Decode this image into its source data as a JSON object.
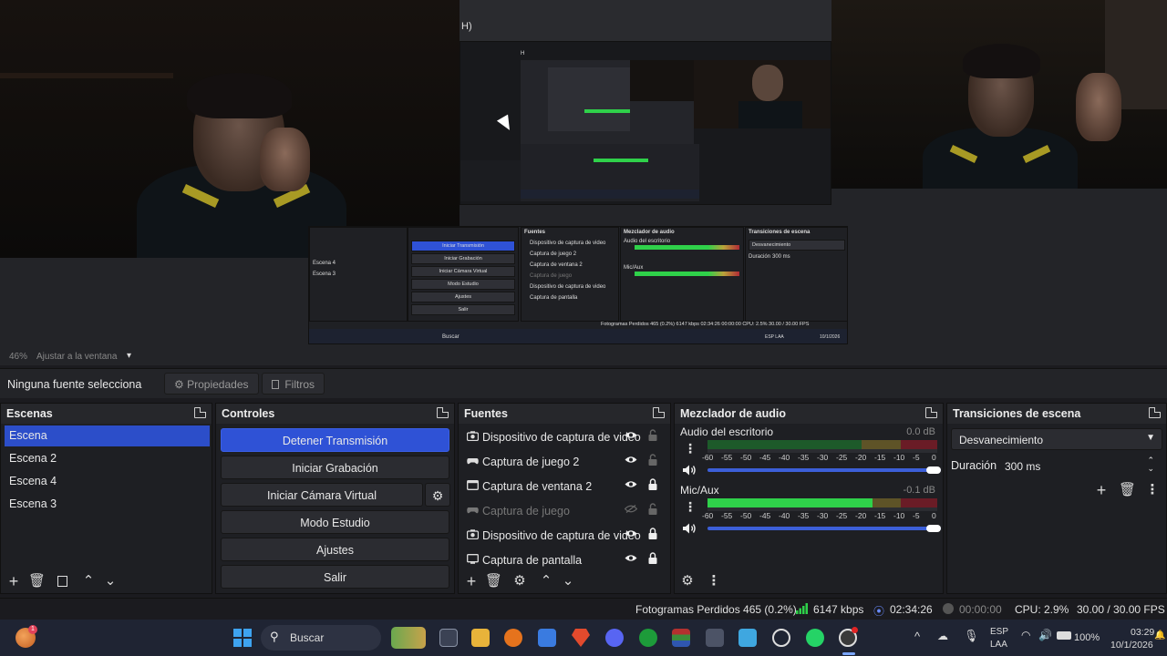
{
  "preview": {
    "nested_header_fragment": "H)",
    "nested_inner_fragment": "H",
    "nested_ui": {
      "scene_items": [
        "Escena 4",
        "Escena 3"
      ],
      "controls": [
        "Iniciar Transmisión",
        "Iniciar Grabación",
        "Iniciar Cámara Virtual",
        "Modo Estudio",
        "Ajustes",
        "Salir"
      ],
      "sources_title": "Fuentes",
      "sources": [
        "Dispositivo de captura de video",
        "Captura de juego 2",
        "Captura de ventana 2",
        "Captura de juego",
        "Dispositivo de captura de video",
        "Captura de pantalla"
      ],
      "mixer_title": "Mezclador de audio",
      "mixer_channels": [
        "Audio del escritorio",
        "Mic/Aux"
      ],
      "transitions_title": "Transiciones de escena",
      "transition": "Desvanecimiento",
      "duration_label": "Duración",
      "duration_value": "300 ms",
      "status": "Fotogramas Perdidos 465 (0.2%)   6147 kbps   02:34:26   00:00:00   CPU: 2.5%   30.00 / 30.00 FPS",
      "search": "Buscar",
      "lang": "ESP LAA",
      "clock": "10/1/2026"
    }
  },
  "zoom": {
    "percent": "46%",
    "mode": "Ajustar a la ventana"
  },
  "context_bar": {
    "label": "Ninguna fuente selecciona",
    "properties": "Propiedades",
    "filters": "Filtros"
  },
  "scenes": {
    "title": "Escenas",
    "items": [
      "Escena",
      "Escena 2",
      "Escena 4",
      "Escena 3"
    ],
    "active_index": 0
  },
  "controls": {
    "title": "Controles",
    "stop_stream": "Detener Transmisión",
    "start_recording": "Iniciar Grabación",
    "start_virtual_cam": "Iniciar Cámara Virtual",
    "studio_mode": "Modo Estudio",
    "settings": "Ajustes",
    "exit": "Salir"
  },
  "sources": {
    "title": "Fuentes",
    "items": [
      {
        "name": "Dispositivo de captura de video",
        "icon": "camera-icon",
        "visible": true,
        "locked": false
      },
      {
        "name": "Captura de juego 2",
        "icon": "gamepad-icon",
        "visible": true,
        "locked": false
      },
      {
        "name": "Captura de ventana 2",
        "icon": "window-icon",
        "visible": true,
        "locked": true
      },
      {
        "name": "Captura de juego",
        "icon": "gamepad-icon",
        "visible": false,
        "locked": false
      },
      {
        "name": "Dispositivo de captura de video",
        "icon": "camera-icon",
        "visible": true,
        "locked": true
      },
      {
        "name": "Captura de pantalla",
        "icon": "monitor-icon",
        "visible": true,
        "locked": true
      }
    ]
  },
  "mixer": {
    "title": "Mezclador de audio",
    "channels": [
      {
        "name": "Audio del escritorio",
        "db": "0.0 dB",
        "level": 0.0,
        "volume": 1.0
      },
      {
        "name": "Mic/Aux",
        "db": "-0.1 dB",
        "level": 0.72,
        "volume": 1.0
      }
    ],
    "scale": [
      "-60",
      "-55",
      "-50",
      "-45",
      "-40",
      "-35",
      "-30",
      "-25",
      "-20",
      "-15",
      "-10",
      "-5",
      "0"
    ]
  },
  "transitions": {
    "title": "Transiciones de escena",
    "selected": "Desvanecimiento",
    "duration_label": "Duración",
    "duration_value": "300 ms"
  },
  "status": {
    "dropped_frames": "Fotogramas Perdidos 465 (0.2%)",
    "bitrate": "6147 kbps",
    "stream_time": "02:34:26",
    "record_time": "00:00:00",
    "cpu": "CPU: 2.9%",
    "fps": "30.00 / 30.00 FPS"
  },
  "taskbar": {
    "search": "Buscar",
    "lang_top": "ESP",
    "lang_bottom": "LAA",
    "battery": "100%",
    "time": "03:29",
    "date": "10/1/2026",
    "notification_badge": "1"
  },
  "colors": {
    "accent": "#2f52d6",
    "meter_green": "#2fd14a",
    "meter_yellow": "#b9a23a",
    "meter_red": "#b02a35"
  }
}
